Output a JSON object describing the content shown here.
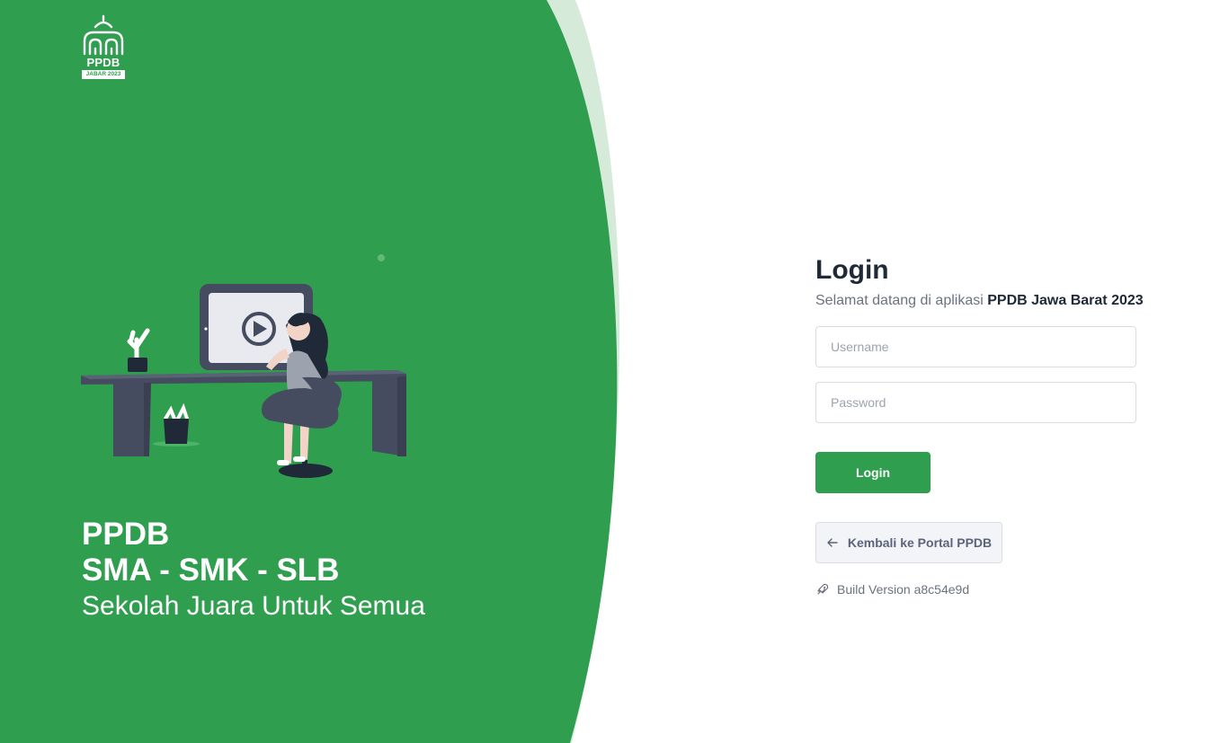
{
  "brand": {
    "logo_text": "PPDB",
    "logo_subtext": "JABAR 2023",
    "colors": {
      "primary_green": "#2f9e4f",
      "light_green": "#d6ead9",
      "dark_text": "#1f2937",
      "muted_text": "#6b7280"
    }
  },
  "hero": {
    "line1": "PPDB",
    "line2": "SMA - SMK - SLB",
    "line3": "Sekolah Juara Untuk Semua"
  },
  "login": {
    "title": "Login",
    "welcome_prefix": "Selamat datang di aplikasi ",
    "welcome_app": "PPDB Jawa Barat 2023",
    "username_placeholder": "Username",
    "password_placeholder": "Password",
    "login_button": "Login",
    "back_button": "Kembali ke Portal PPDB",
    "back_icon": "arrow-left-icon",
    "build_icon": "rocket-icon",
    "build_version": "Build Version a8c54e9d"
  }
}
